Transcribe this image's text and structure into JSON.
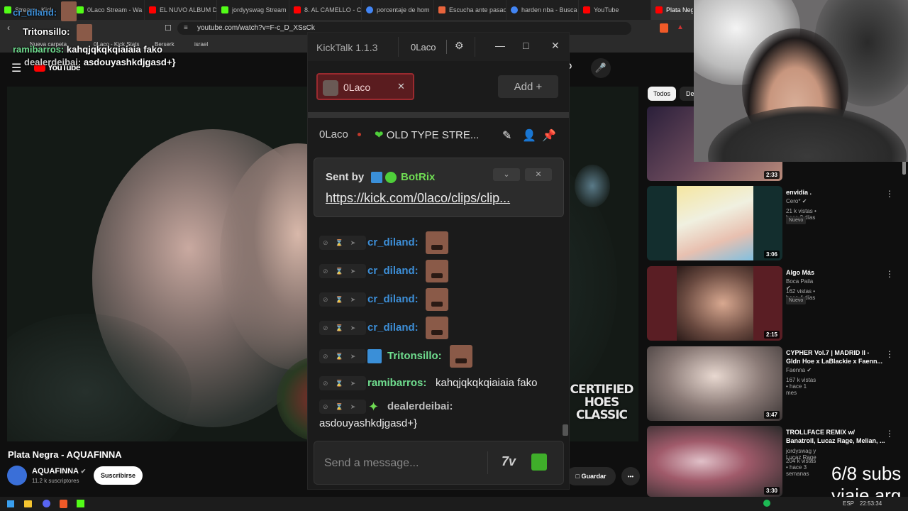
{
  "browser": {
    "tabs": [
      {
        "label": "Stream - Kick",
        "color": "#53fc18"
      },
      {
        "label": "0Laco Stream - Wa",
        "color": "#53fc18"
      },
      {
        "label": "EL NUVO ALBUM D",
        "color": "#ff0000"
      },
      {
        "label": "jordyyswag Stream",
        "color": "#53fc18"
      },
      {
        "label": "8. AL CAMELLO - C",
        "color": "#ff0000"
      },
      {
        "label": "porcentaje de hom",
        "color": "#4285f4"
      },
      {
        "label": "Escucha ante pasao",
        "color": "#e8643c"
      },
      {
        "label": "harden nba - Busca",
        "color": "#4285f4"
      },
      {
        "label": "YouTube",
        "color": "#ff0000"
      },
      {
        "label": "Plata Negra",
        "color": "#ff0000"
      }
    ],
    "url": "youtube.com/watch?v=F-c_D_XSsCk",
    "bookmarks": [
      "Nueva carpeta",
      "0Laco - Kick Stats",
      "Berserk",
      "israel"
    ]
  },
  "youtube": {
    "logo": "YouTube",
    "video_title": "Plata Negra - AQUAFINNA",
    "channel": "AQUAFINNA",
    "subscribers": "11.2 k suscriptores",
    "subscribe_label": "Suscribirse",
    "save_label": "Guardar",
    "more_label": "•••",
    "video_overlay": "CERTIFIED HOES CLASSIC",
    "chips": [
      "Todos",
      "De"
    ],
    "recommendations": [
      {
        "title": "",
        "channel": "",
        "meta": "",
        "duration": "2:33",
        "badge": ""
      },
      {
        "title": "envidia .",
        "channel": "Cero*",
        "meta": "21 k vistas • hace 2 días",
        "duration": "3:06",
        "badge": "Nuevo"
      },
      {
        "title": "Algo Más",
        "channel": "Boca Paila",
        "meta": "162 vistas • hace 4 días",
        "duration": "2:15",
        "badge": "Nuevo"
      },
      {
        "title": "CYPHER Vol.7 | MADRID II - Gldn Hoe x LaBlackie x Faenn...",
        "channel": "Faenna",
        "meta": "167 k vistas • hace 1 mes",
        "duration": "3:47",
        "badge": ""
      },
      {
        "title": "TROLLFACE REMIX w/ Banatroll, Lucaz Rage, Melian, ...",
        "channel": "jordyswag y Lucaz Rage",
        "meta": "204 k vistas • hace 3 semanas",
        "duration": "3:30",
        "badge": ""
      }
    ]
  },
  "kicktalk": {
    "title": "KickTalk 1.1.3",
    "user": "0Laco",
    "channel_tab": "0Laco",
    "add_label": "Add",
    "channel_name": "0Laco",
    "stream_title": "OLD TYPE STRE...",
    "pinned": {
      "sent_by": "Sent by",
      "bot": "BotRix",
      "link": "https://kick.com/0laco/clips/clip..."
    },
    "messages": [
      {
        "user": "cr_diland:",
        "color": "#3d8fd8",
        "text": ""
      },
      {
        "user": "cr_diland:",
        "color": "#3d8fd8",
        "text": ""
      },
      {
        "user": "cr_diland:",
        "color": "#3d8fd8",
        "text": ""
      },
      {
        "user": "cr_diland:",
        "color": "#3d8fd8",
        "text": ""
      },
      {
        "user": "Tritonsillo:",
        "color": "#6fdc8e",
        "text": ""
      },
      {
        "user": "ramibarros:",
        "color": "#6fdc8e",
        "text": "kahqjqkqkqiaiaia fako"
      },
      {
        "user": "dealerdeibai:",
        "color": "#bbbbbb",
        "text": ""
      }
    ],
    "continuation": "asdouyashkdjgasd+}",
    "input_placeholder": "Send a message...",
    "seventv_label": "7v"
  },
  "overlay": {
    "chat": [
      {
        "user": "cr_diland:",
        "text": ""
      },
      {
        "user": "Tritonsillo:",
        "text": ""
      },
      {
        "user": "ramibarros:",
        "text": "kahqjqkqkqiaiaia fako"
      },
      {
        "user": "dealerdeibai:",
        "text": "asdouyashkdjgasd+}"
      }
    ],
    "subs_goal": "6/8 subs",
    "trip": "viaje arg"
  },
  "taskbar": {
    "lang": "ESP",
    "time": "22:53:34"
  },
  "colors": {
    "kick_green": "#53fc18",
    "youtube_red": "#ff0000",
    "kt_tab_red": "#5a1c1f"
  }
}
